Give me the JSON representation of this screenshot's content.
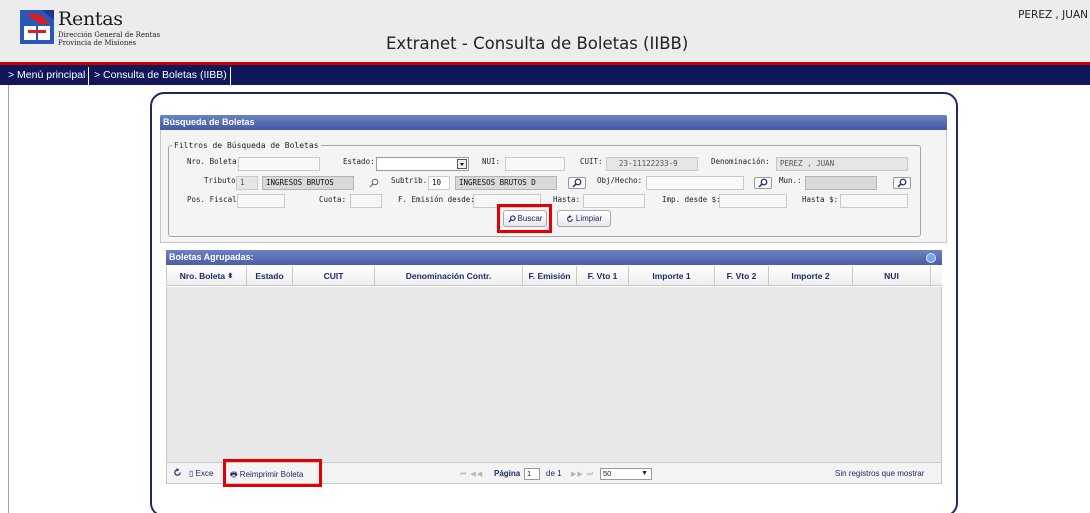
{
  "header": {
    "logo_title": "Rentas",
    "logo_sub1": "Dirección General de Rentas",
    "logo_sub2": "Provincia de Misiones",
    "page_title": "Extranet - Consulta de Boletas (IIBB)",
    "user": "PEREZ , JUAN"
  },
  "nav": {
    "items": [
      "> Menú principal",
      "> Consulta de Boletas (IIBB)"
    ]
  },
  "search": {
    "section_title": "Búsqueda de Boletas",
    "legend": "Filtros de Búsqueda de Boletas",
    "labels": {
      "nro_boleta": "Nro. Boleta:",
      "estado": "Estado:",
      "nui": "NUI:",
      "cuit": "CUIT:",
      "denominacion": "Denominación:",
      "tributo": "Tributo:",
      "subtrib": "Subtrib.:",
      "obj_hecho": "Obj/Hecho:",
      "mun": "Mun.:",
      "pos_fiscal": "Pos. Fiscal:",
      "cuota": "Cuota:",
      "f_emision_desde": "F. Emisión desde:",
      "hasta": "Hasta:",
      "imp_desde": "Imp. desde $:",
      "hasta_imp": "Hasta $:"
    },
    "values": {
      "cuit": "23-11122233-9",
      "denominacion": "PEREZ , JUAN",
      "tributo_code": "1",
      "tributo_name": "INGRESOS BRUTOS",
      "subtrib_code": "10",
      "subtrib_name": "INGRESOS BRUTOS D"
    },
    "buttons": {
      "buscar": "Buscar",
      "limpiar": "Limpiar"
    }
  },
  "grid": {
    "title": "Boletas Agrupadas:",
    "columns": [
      "Nro. Boleta",
      "Estado",
      "CUIT",
      "Denominación Contr.",
      "F. Emisión",
      "F. Vto 1",
      "Importe 1",
      "F. Vto 2",
      "Importe 2",
      "NUI"
    ],
    "toolbar": {
      "excel": "Exce",
      "reimprimir": "Reimprimir Boleta",
      "pagina": "Página",
      "page_value": "1",
      "de": "de 1",
      "page_size": "50",
      "status": "Sin registros que mostrar"
    }
  },
  "colors": {
    "nav_bg": "#10175a",
    "nav_border": "#c80000",
    "highlight": "#e40000",
    "panel_border": "#1d2a66"
  }
}
